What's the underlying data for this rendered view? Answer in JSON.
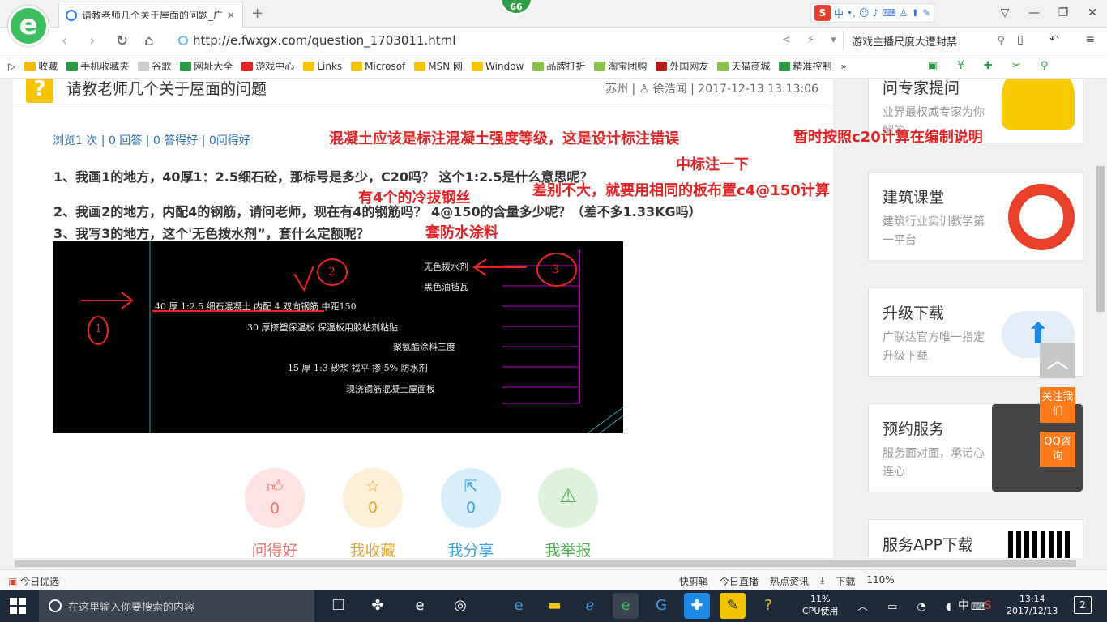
{
  "browser": {
    "tab_title": "请教老师几个关于屋面的问题_广",
    "badge_count": "66",
    "url": "http://e.fwxgx.com/question_1703011.html",
    "search_text": "游戏主播尺度大遭封禁",
    "sogou": {
      "lang": "中",
      "punct": "•,",
      "emoji": "☺"
    },
    "bookmarks": [
      {
        "label": "收藏",
        "color": "#f5b800"
      },
      {
        "label": "手机收藏夹",
        "color": "#2c9a44"
      },
      {
        "label": "谷歌",
        "color": "#cccccc"
      },
      {
        "label": "网址大全",
        "color": "#2c9a44"
      },
      {
        "label": "游戏中心",
        "color": "#e22424"
      },
      {
        "label": "Links",
        "color": "#f5c400"
      },
      {
        "label": "Microsof",
        "color": "#f5c400"
      },
      {
        "label": "MSN 网",
        "color": "#f5c400"
      },
      {
        "label": "Window",
        "color": "#f5c400"
      },
      {
        "label": "品牌打折",
        "color": "#8bc34a"
      },
      {
        "label": "淘宝团购",
        "color": "#8bc34a"
      },
      {
        "label": "外国网友",
        "color": "#b71c1c"
      },
      {
        "label": "天猫商城",
        "color": "#8bc34a"
      },
      {
        "label": "精准控制",
        "color": "#2c9a44"
      }
    ],
    "bookmarks_more": "»"
  },
  "question": {
    "title": "请教老师几个关于屋面的问题",
    "location": "苏州",
    "author": "徐浩闻",
    "date": "2017-12-13 13:13:06",
    "stats": "浏览1 次 | 0 回答 | 0 答得好 | 0问得好",
    "q1": "1、我画1的地方，40厚1：2.5细石砼，那标号是多少，C20吗？  这个1:2.5是什么意思呢？",
    "q2": "2、我画2的地方，内配4的钢筋，请问老师，现在有4的钢筋吗？ 4@150的含量多少呢？（差不多1.33KG吗）",
    "q3": "3、我写3的地方，这个'无色拨水剂”，套什么定额呢？"
  },
  "annotations": {
    "a1": "混凝土应该是标注混凝土强度等级，这是设计标注错误",
    "a2": "暂时按照c20计算在编制说明",
    "a3": "中标注一下",
    "a4": "差别不大，就要用相同的板布置c4@150计算",
    "a5": "有4个的冷拔钢丝",
    "a6": "套防水涂料"
  },
  "cad": {
    "l1": "无色拨水剂",
    "l2": "黑色油毡瓦",
    "l3": "40  厚  1:2.5      细石混凝土  内配  4 双向钢筋 中距150",
    "l4": "30  厚挤塑保温板 保温板用胶粘剂粘贴",
    "l5": "聚氨酯涂料三度",
    "l6": "15  厚  1:3    砂浆    找平    掺 5% 防水剂",
    "l7": "现浇钢筋混凝土屋面板",
    "m1": "1",
    "m2": "2",
    "m3": "3"
  },
  "actions": [
    {
      "label": "问得好",
      "count": "0",
      "color": "#f07070",
      "bg": "#fde3e3"
    },
    {
      "label": "我收藏",
      "count": "0",
      "color": "#e8a52a",
      "bg": "#fdf0d6"
    },
    {
      "label": "我分享",
      "count": "0",
      "color": "#3a9ee8",
      "bg": "#d9eefb"
    },
    {
      "label": "我举报",
      "count": "",
      "color": "#4caf50",
      "bg": "#def3dc"
    }
  ],
  "sidebar": {
    "c0_title": "问专家提问",
    "c0_sub": "业界最权威专家为你解答",
    "c1_title": "建筑课堂",
    "c1_sub": "建筑行业实训教学第一平台",
    "c2_title": "升级下载",
    "c2_sub": "广联达官方唯一指定升级下载",
    "c3_title": "预约服务",
    "c3_sub": "服务面对面，承诺心连心",
    "c4_title": "服务APP下载",
    "follow": "关注我们",
    "qq": "QQ咨询"
  },
  "status": {
    "left": "今日优选",
    "items": [
      "快剪辑",
      "今日直播",
      "热点资讯",
      "下载",
      "110%"
    ]
  },
  "taskbar": {
    "search_placeholder": "在这里输入你要搜索的内容",
    "cpu_percent": "11%",
    "cpu_label": "CPU使用",
    "ime": "中",
    "time": "13:14",
    "date": "2017/12/13",
    "notifications": "2"
  }
}
